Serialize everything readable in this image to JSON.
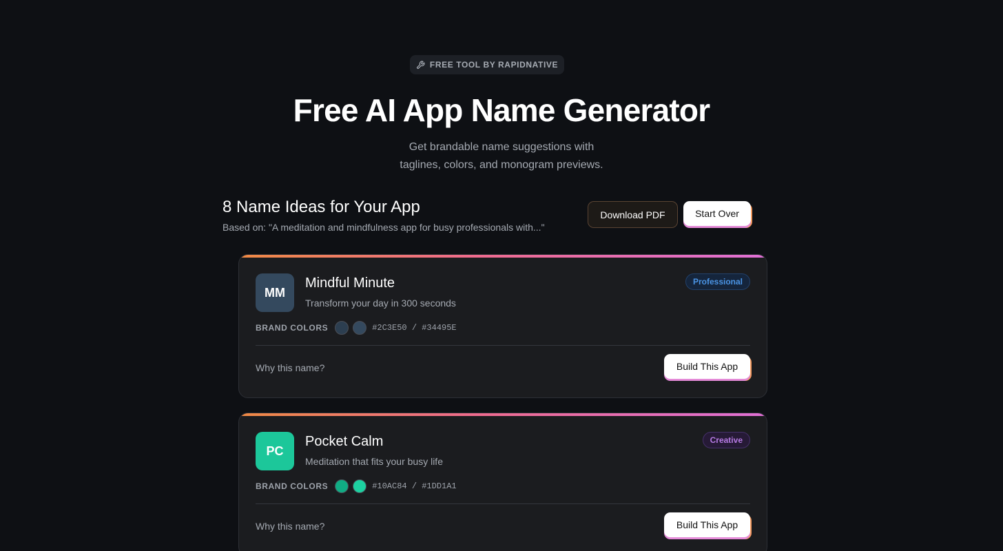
{
  "header": {
    "badge_label": "FREE TOOL BY RAPIDNATIVE",
    "badge_icon": "wrench-icon",
    "title": "Free AI App Name Generator",
    "subtitle_line1": "Get brandable name suggestions with",
    "subtitle_line2": "taglines, colors, and monogram previews."
  },
  "results": {
    "title": "8 Name Ideas for Your App",
    "based_on": "Based on: \"A meditation and mindfulness app for busy professionals with...\"",
    "download_label": "Download PDF",
    "start_over_label": "Start Over"
  },
  "cards": [
    {
      "monogram": "MM",
      "name": "Mindful Minute",
      "tagline": "Transform your day in 300 seconds",
      "category": "Professional",
      "brand_colors_label": "BRAND COLORS",
      "primary_color": "#2C3E50",
      "secondary_color": "#34495E",
      "hex_text": "#2C3E50 / #34495E",
      "why_label": "Why this name?",
      "build_label": "Build This App"
    },
    {
      "monogram": "PC",
      "name": "Pocket Calm",
      "tagline": "Meditation that fits your busy life",
      "category": "Creative",
      "brand_colors_label": "BRAND COLORS",
      "primary_color": "#10AC84",
      "secondary_color": "#1DD1A1",
      "hex_text": "#10AC84 / #1DD1A1",
      "why_label": "Why this name?",
      "build_label": "Build This App"
    }
  ],
  "theme": {
    "background": "#0e1014",
    "card_background": "#1b1c1f",
    "accent_orange": "#f08a44",
    "accent_pink": "#e070d6"
  }
}
